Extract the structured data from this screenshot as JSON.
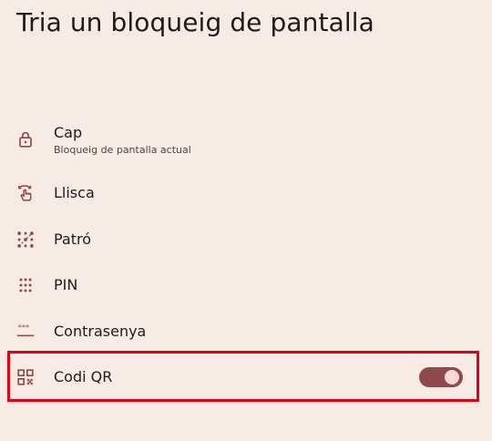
{
  "page": {
    "title": "Tria un bloqueig de pantalla"
  },
  "options": [
    {
      "id": "cap",
      "label": "Cap",
      "sublabel": "Bloqueig de pantalla actual",
      "icon": "lock-icon"
    },
    {
      "id": "swipe",
      "label": "Llisca",
      "icon": "swipe-icon"
    },
    {
      "id": "pattern",
      "label": "Patró",
      "icon": "pattern-icon"
    },
    {
      "id": "pin",
      "label": "PIN",
      "icon": "pin-dialpad-icon"
    },
    {
      "id": "password",
      "label": "Contrasenya",
      "icon": "password-icon"
    },
    {
      "id": "qr",
      "label": "Codi QR",
      "icon": "qr-code-icon",
      "toggle_on": true
    }
  ],
  "colors": {
    "background": "#f7ebe6",
    "icon": "#8e4a4a",
    "highlight": "#e6000e",
    "toggle_track": "#8e4a4a",
    "toggle_thumb": "#ffd9d5"
  }
}
